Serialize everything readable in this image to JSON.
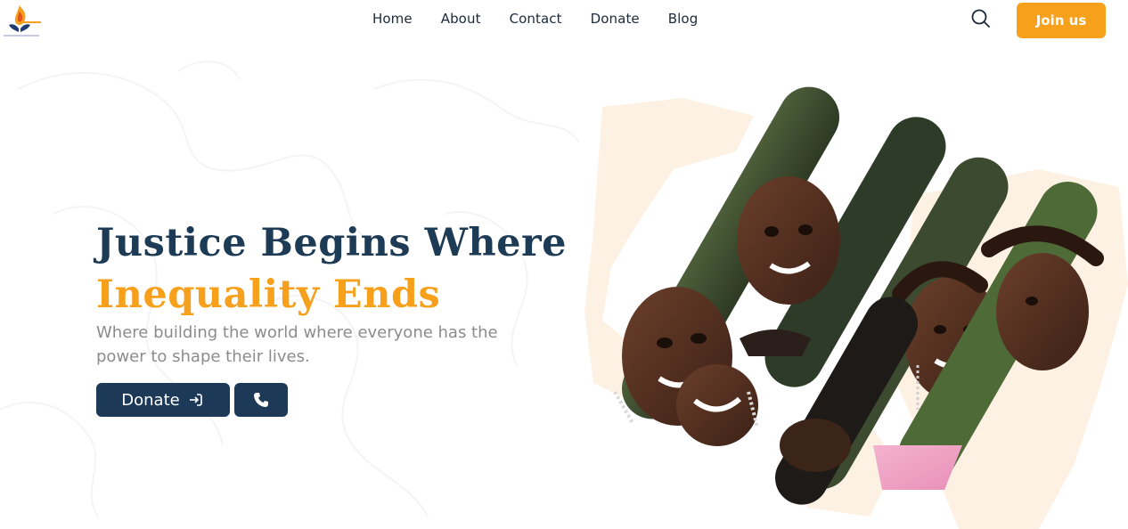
{
  "header": {
    "logo_icon": "flame-hands-logo",
    "nav": [
      {
        "label": "Home"
      },
      {
        "label": "About"
      },
      {
        "label": "Contact"
      },
      {
        "label": "Donate"
      },
      {
        "label": "Blog"
      }
    ],
    "search_icon": "search-icon",
    "join_label": "Join us"
  },
  "hero": {
    "title_line1": "Justice Begins Where",
    "title_line2": "Inequality Ends",
    "subtitle": "Where building the world where everyone has the power to shape their lives.",
    "donate_label": "Donate",
    "donate_icon": "sign-in-arrow-icon",
    "phone_icon": "phone-icon"
  },
  "colors": {
    "navy": "#1c3a57",
    "orange": "#f7a01b",
    "peach": "#fdf1e4",
    "text_gray": "#8c8c8c"
  }
}
